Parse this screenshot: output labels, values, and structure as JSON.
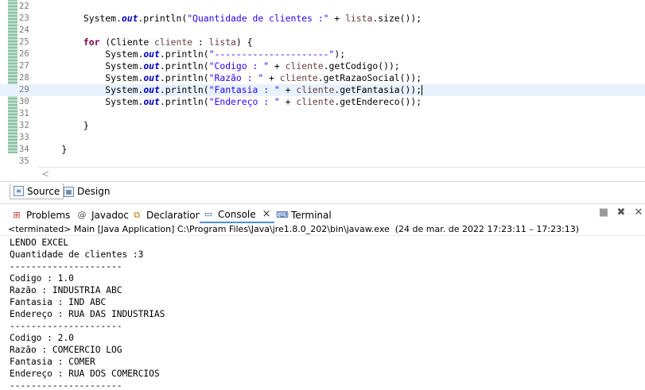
{
  "editor": {
    "lines": [
      {
        "num": "22",
        "tokens": []
      },
      {
        "num": "23",
        "tokens": [
          {
            "t": "        System.",
            "c": ""
          },
          {
            "t": "out",
            "c": "fld"
          },
          {
            "t": ".println(",
            "c": ""
          },
          {
            "t": "\"Quantidade de clientes :\"",
            "c": "str"
          },
          {
            "t": " + ",
            "c": ""
          },
          {
            "t": "lista",
            "c": "var"
          },
          {
            "t": ".size());",
            "c": ""
          }
        ]
      },
      {
        "num": "24",
        "tokens": []
      },
      {
        "num": "25",
        "tokens": [
          {
            "t": "        ",
            "c": ""
          },
          {
            "t": "for",
            "c": "kw"
          },
          {
            "t": " (Cliente ",
            "c": ""
          },
          {
            "t": "cliente",
            "c": "var"
          },
          {
            "t": " : ",
            "c": ""
          },
          {
            "t": "lista",
            "c": "var"
          },
          {
            "t": ") {",
            "c": ""
          }
        ]
      },
      {
        "num": "26",
        "tokens": [
          {
            "t": "            System.",
            "c": ""
          },
          {
            "t": "out",
            "c": "fld"
          },
          {
            "t": ".println(",
            "c": ""
          },
          {
            "t": "\"---------------------\"",
            "c": "str"
          },
          {
            "t": ");",
            "c": ""
          }
        ]
      },
      {
        "num": "27",
        "tokens": [
          {
            "t": "            System.",
            "c": ""
          },
          {
            "t": "out",
            "c": "fld"
          },
          {
            "t": ".println(",
            "c": ""
          },
          {
            "t": "\"Codigo : \"",
            "c": "str"
          },
          {
            "t": " + ",
            "c": ""
          },
          {
            "t": "cliente",
            "c": "var"
          },
          {
            "t": ".getCodigo());",
            "c": ""
          }
        ]
      },
      {
        "num": "28",
        "tokens": [
          {
            "t": "            System.",
            "c": ""
          },
          {
            "t": "out",
            "c": "fld"
          },
          {
            "t": ".println(",
            "c": ""
          },
          {
            "t": "\"Razão : \"",
            "c": "str"
          },
          {
            "t": " + ",
            "c": ""
          },
          {
            "t": "cliente",
            "c": "var"
          },
          {
            "t": ".getRazaoSocial());",
            "c": ""
          }
        ]
      },
      {
        "num": "29",
        "current": true,
        "caret": true,
        "tokens": [
          {
            "t": "            System.",
            "c": ""
          },
          {
            "t": "out",
            "c": "fld"
          },
          {
            "t": ".println(",
            "c": ""
          },
          {
            "t": "\"Fantasia : \"",
            "c": "str"
          },
          {
            "t": " + ",
            "c": ""
          },
          {
            "t": "cliente",
            "c": "var"
          },
          {
            "t": ".getFantasia());",
            "c": ""
          }
        ]
      },
      {
        "num": "30",
        "tokens": [
          {
            "t": "            System.",
            "c": ""
          },
          {
            "t": "out",
            "c": "fld"
          },
          {
            "t": ".println(",
            "c": ""
          },
          {
            "t": "\"Endereço : \"",
            "c": "str"
          },
          {
            "t": " + ",
            "c": ""
          },
          {
            "t": "cliente",
            "c": "var"
          },
          {
            "t": ".getEndereco());",
            "c": ""
          }
        ]
      },
      {
        "num": "31",
        "tokens": []
      },
      {
        "num": "32",
        "tokens": [
          {
            "t": "        }",
            "c": ""
          }
        ]
      },
      {
        "num": "33",
        "tokens": []
      },
      {
        "num": "34",
        "tokens": [
          {
            "t": "    }",
            "c": ""
          }
        ]
      },
      {
        "num": "35",
        "tokens": []
      }
    ],
    "scroll_left_glyph": "<"
  },
  "editor_tabs": {
    "source_label": "Source",
    "design_label": "Design"
  },
  "view_tabs": {
    "problems": "Problems",
    "javadoc": "Javadoc",
    "declaration": "Declaration",
    "console": "Console",
    "terminal": "Terminal"
  },
  "console": {
    "header": "<terminated> Main [Java Application] C:\\Program Files\\Java\\jre1.8.0_202\\bin\\javaw.exe  (24 de mar. de 2022 17:23:11 – 17:23:13)",
    "output": [
      "LENDO EXCEL",
      "Quantidade de clientes :3",
      "---------------------",
      "Codigo : 1.0",
      "Razão : INDUSTRIA ABC",
      "Fantasia : IND ABC",
      "Endereço : RUA DAS INDUSTRIAS",
      "---------------------",
      "Codigo : 2.0",
      "Razão : COMCERCIO LOG",
      "Fantasia : COMER",
      "Endereço : RUA DOS COMERCIOS",
      "---------------------"
    ]
  },
  "icons": {
    "source": "source-editor-icon",
    "design": "design-editor-icon",
    "problems": "problems-icon",
    "javadoc": "javadoc-icon",
    "declaration": "declaration-icon",
    "console": "console-icon",
    "terminal": "terminal-icon",
    "terminate": "terminate-icon",
    "remove_all": "remove-all-terminated-icon"
  }
}
